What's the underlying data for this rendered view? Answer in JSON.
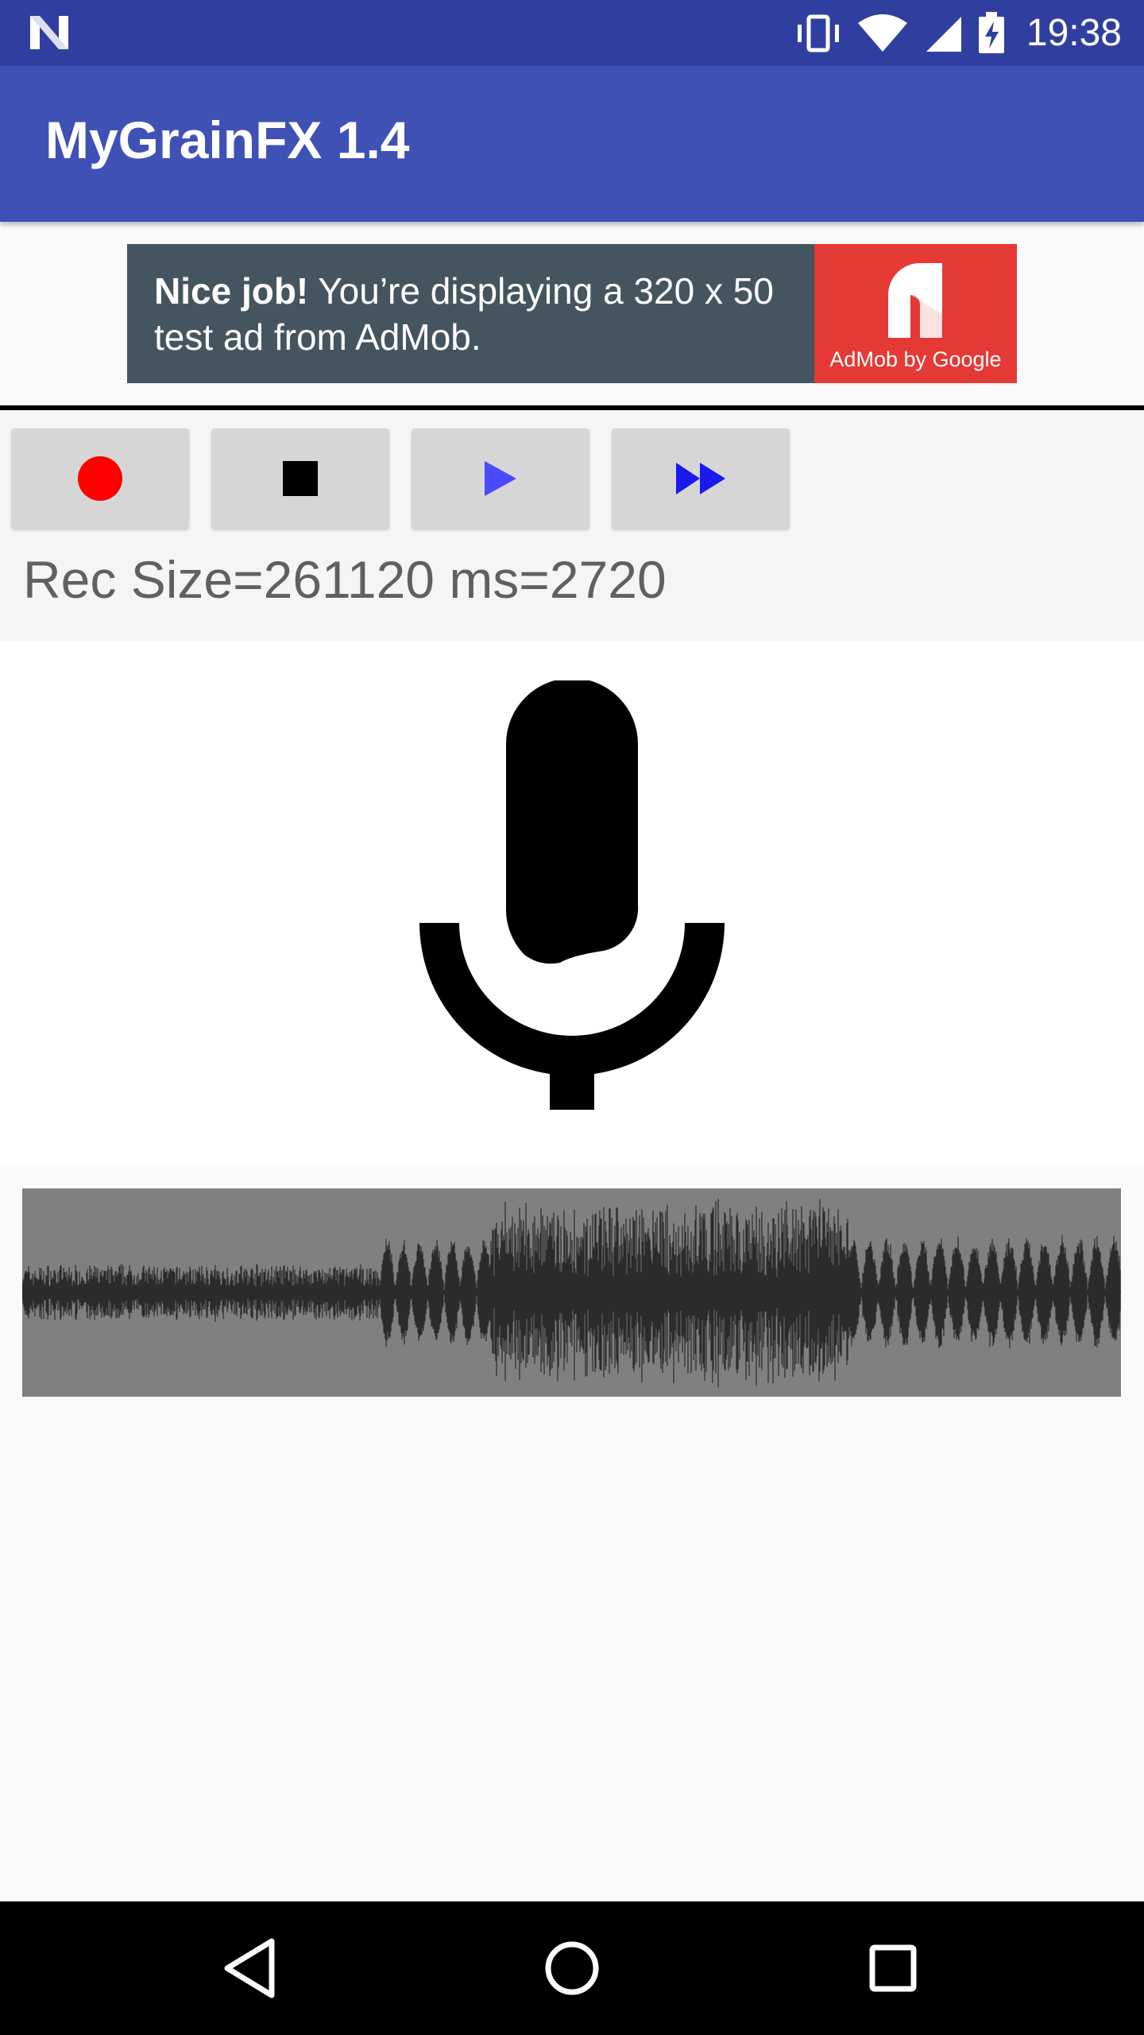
{
  "status_bar": {
    "time": "19:38",
    "icons": [
      "notification-n-icon",
      "vibrate-icon",
      "wifi-icon",
      "signal-icon",
      "battery-charging-icon"
    ]
  },
  "app_bar": {
    "title": "MyGrainFX 1.4"
  },
  "ad": {
    "headline": "Nice job!",
    "body": " You’re displaying a 320 x 50 test ad from AdMob.",
    "brand": "AdMob by Google"
  },
  "controls": {
    "buttons": [
      {
        "name": "record",
        "icon": "record-dot-icon",
        "color": "#ff0000"
      },
      {
        "name": "stop",
        "icon": "stop-square-icon",
        "color": "#000000"
      },
      {
        "name": "play",
        "icon": "play-icon",
        "color": "#4a4aff"
      },
      {
        "name": "fast-forward",
        "icon": "fast-forward-icon",
        "color": "#1a1aee"
      }
    ],
    "rec_info": "Rec Size=261120 ms=2720"
  },
  "mic": {
    "icon": "microphone-icon"
  },
  "waveform": {
    "background": "#808080",
    "trace_color": "#2b2b2b"
  },
  "nav_bar": {
    "icons": [
      "back-icon",
      "home-icon",
      "recents-icon"
    ]
  }
}
